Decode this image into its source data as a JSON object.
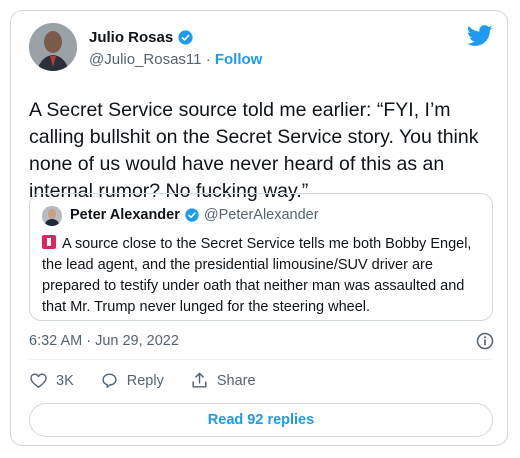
{
  "author": {
    "name": "Julio Rosas",
    "handle": "@Julio_Rosas11",
    "separator": "·",
    "follow_label": "Follow"
  },
  "tweet": {
    "text": "A Secret Service source told me earlier: “FYI, I’m calling bullshit on the Secret Service story. You think none of us would have never heard of this as an internal rumor? No fucking way.”",
    "timestamp": "6:32 AM · Jun 29, 2022",
    "like_count": "3K",
    "reply_label": "Reply",
    "share_label": "Share",
    "read_replies_label": "Read 92 replies"
  },
  "quoted_tweet": {
    "name": "Peter Alexander",
    "handle": "@PeterAlexander",
    "text": "A source close to the Secret Service tells me both Bobby Engel, the lead agent, and the presidential limousine/SUV driver are prepared to testify under oath that neither man was assaulted and that Mr. Trump never lunged for the steering wheel."
  },
  "colors": {
    "brand_blue": "#1d9bf0",
    "text_primary": "#0f1419",
    "text_secondary": "#536471",
    "border": "#cfd9de",
    "siren_red": "#e0245e"
  },
  "icons": [
    "twitter-bird-icon",
    "verified-badge-icon",
    "siren-emoji-icon",
    "info-icon",
    "heart-icon",
    "reply-icon",
    "share-icon"
  ]
}
